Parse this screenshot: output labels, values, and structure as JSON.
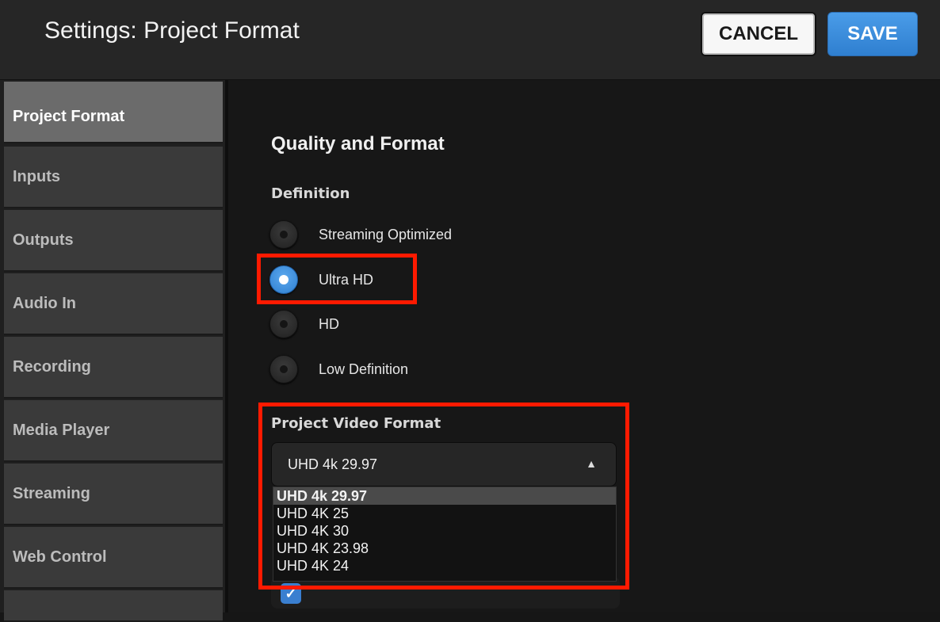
{
  "header": {
    "title": "Settings: Project Format",
    "cancel_label": "CANCEL",
    "save_label": "SAVE"
  },
  "sidebar": {
    "items": [
      {
        "label": "Project Format",
        "active": true
      },
      {
        "label": "Inputs",
        "active": false
      },
      {
        "label": "Outputs",
        "active": false
      },
      {
        "label": "Audio In",
        "active": false
      },
      {
        "label": "Recording",
        "active": false
      },
      {
        "label": "Media Player",
        "active": false
      },
      {
        "label": "Streaming",
        "active": false
      },
      {
        "label": "Web Control",
        "active": false
      }
    ]
  },
  "main": {
    "section_title": "Quality and Format",
    "definition": {
      "label": "Definition",
      "options": [
        {
          "label": "Streaming Optimized",
          "selected": false
        },
        {
          "label": "Ultra HD",
          "selected": true
        },
        {
          "label": "HD",
          "selected": false
        },
        {
          "label": "Low Definition",
          "selected": false
        }
      ]
    },
    "video_format": {
      "label": "Project Video Format",
      "value": "UHD 4k 29.97",
      "options": [
        {
          "label": "UHD 4k 29.97",
          "selected": true
        },
        {
          "label": "UHD 4K 25",
          "selected": false
        },
        {
          "label": "UHD 4K 30",
          "selected": false
        },
        {
          "label": "UHD 4K 23.98",
          "selected": false
        },
        {
          "label": "UHD 4K 24",
          "selected": false
        }
      ]
    }
  },
  "colors": {
    "accent": "#2f7fd0",
    "highlight": "#ff1a00",
    "background": "#161616"
  }
}
